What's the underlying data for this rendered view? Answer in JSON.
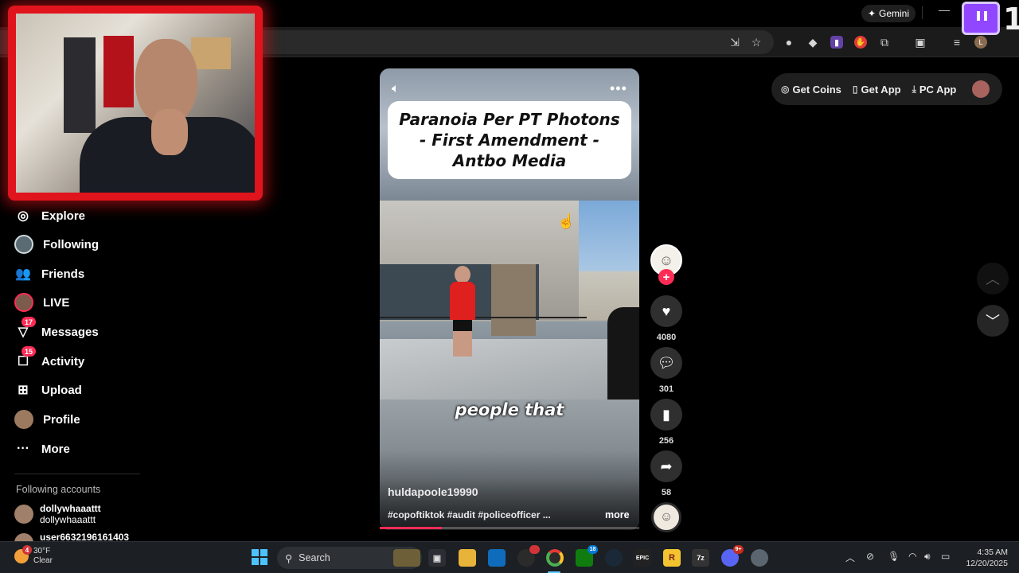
{
  "browser": {
    "gemini_label": "Gemini",
    "profile_initial": "L",
    "twitch_overlay_number": "1"
  },
  "nav": {
    "items": [
      {
        "label": "Explore",
        "icon": "compass-icon"
      },
      {
        "label": "Following",
        "icon": "following-icon"
      },
      {
        "label": "Friends",
        "icon": "friends-icon"
      },
      {
        "label": "LIVE",
        "icon": "live-icon"
      },
      {
        "label": "Messages",
        "icon": "messages-icon",
        "badge": "17"
      },
      {
        "label": "Activity",
        "icon": "activity-icon",
        "badge": "15"
      },
      {
        "label": "Upload",
        "icon": "upload-icon"
      },
      {
        "label": "Profile",
        "icon": "profile-icon"
      },
      {
        "label": "More",
        "icon": "more-icon"
      }
    ],
    "following_heading": "Following accounts",
    "accounts": [
      {
        "username": "dollywhaaattt",
        "nickname": "dollywhaaattt"
      },
      {
        "username": "user6632196161403",
        "nickname": ""
      }
    ]
  },
  "header": {
    "get_coins": "Get Coins",
    "get_app": "Get App",
    "pc_app": "PC App"
  },
  "video": {
    "title_overlay": "Paranoia Per PT Photons - First Amendment - Antbo Media",
    "caption": "people that",
    "author": "huldapoole19990",
    "hashtags": "#copoftiktok #audit #policeofficer ...",
    "more_label": "more",
    "progress": 0.24
  },
  "actions": {
    "likes": "4080",
    "comments": "301",
    "saves": "256",
    "shares": "58"
  },
  "taskbar": {
    "weather_temp": "30°F",
    "weather_desc": "Clear",
    "weather_badge": "4",
    "search_placeholder": "Search",
    "xbox_badge": "18",
    "discord_badge": "9+",
    "time": "4:35 AM",
    "date": "12/20/2025"
  },
  "colors": {
    "accent": "#fe2c55",
    "webcam_border": "#e0141c",
    "twitch": "#9146ff"
  }
}
